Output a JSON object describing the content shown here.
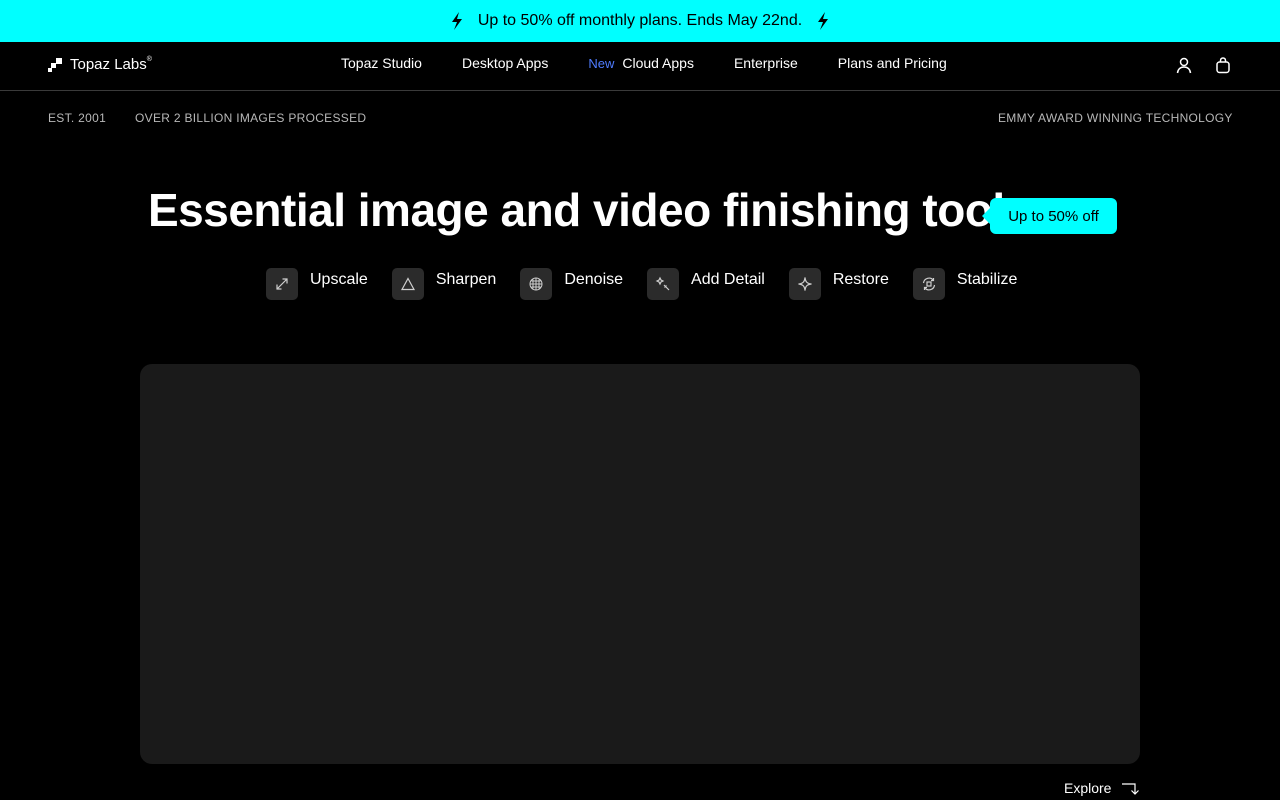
{
  "promo": {
    "text": "Up to 50% off monthly plans. Ends May 22nd.",
    "icon": "lightning-bolt-icon",
    "bg_color": "#00ffff"
  },
  "brand": {
    "name": "Topaz Labs",
    "mark": "®"
  },
  "nav": {
    "items": [
      {
        "label": "Topaz Studio",
        "badge": ""
      },
      {
        "label": "Desktop Apps",
        "badge": ""
      },
      {
        "label": "Cloud Apps",
        "badge": "New"
      },
      {
        "label": "Enterprise",
        "badge": ""
      },
      {
        "label": "Plans and Pricing",
        "badge": ""
      }
    ],
    "badge_color": "#4f7cff",
    "account_icon": "user-icon",
    "cart_icon": "shopping-bag-icon"
  },
  "meta": {
    "est": "EST. 2001",
    "processed": "OVER 2 BILLION IMAGES PROCESSED",
    "award": "EMMY AWARD WINNING TECHNOLOGY"
  },
  "hero": {
    "headline": "Essential image and video finishing tools.",
    "pill": "Up to 50% off",
    "accent_color": "#00ffff"
  },
  "tools": [
    {
      "label": "Upscale",
      "icon": "expand-arrows-icon"
    },
    {
      "label": "Sharpen",
      "icon": "triangle-icon"
    },
    {
      "label": "Denoise",
      "icon": "grid-circle-icon"
    },
    {
      "label": "Add Detail",
      "icon": "sparkle-wand-icon"
    },
    {
      "label": "Restore",
      "icon": "star-sparkle-icon"
    },
    {
      "label": "Stabilize",
      "icon": "rotate-frame-icon"
    }
  ],
  "explore": {
    "label": "Explore",
    "icon": "corner-arrow-icon"
  }
}
